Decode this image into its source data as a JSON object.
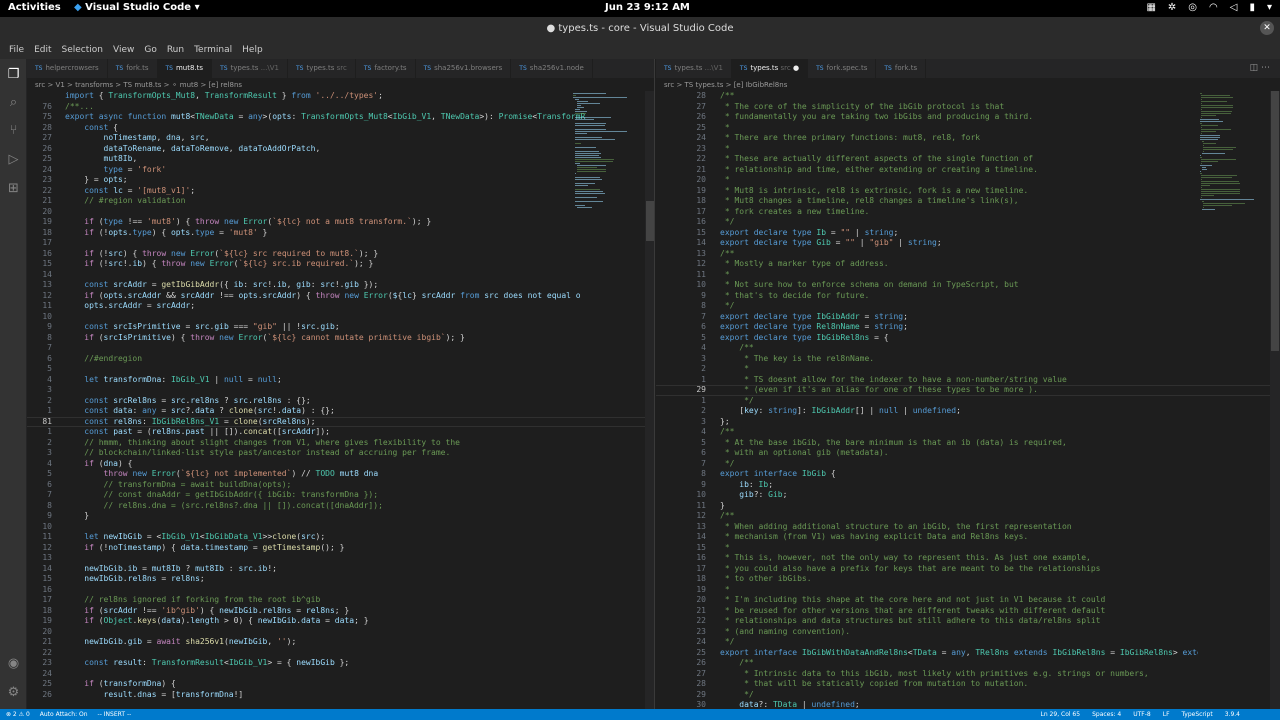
{
  "topbar": {
    "activities": "Activities",
    "app": "Visual Studio Code",
    "clock": "Jun 23  9:12 AM"
  },
  "window": {
    "title": "● types.ts - core - Visual Studio Code"
  },
  "menu": [
    "File",
    "Edit",
    "Selection",
    "View",
    "Go",
    "Run",
    "Terminal",
    "Help"
  ],
  "left": {
    "tabs": [
      {
        "label": "helpercrowsers",
        "dir": "",
        "on": false
      },
      {
        "label": "fork.ts",
        "dir": "",
        "on": false
      },
      {
        "label": "mut8.ts",
        "dir": "",
        "on": true
      },
      {
        "label": "types.ts",
        "dir": "...\\V1",
        "on": false
      },
      {
        "label": "types.ts",
        "dir": "src",
        "on": false
      },
      {
        "label": "factory.ts",
        "dir": "",
        "on": false
      },
      {
        "label": "sha256v1.browsers",
        "dir": "",
        "on": false
      },
      {
        "label": "sha256v1.node",
        "dir": "",
        "on": false
      }
    ],
    "breadcrumb": "src > V1 > transforms > TS mut8.ts > ⚬ mut8 > [e] rel8ns",
    "lines": [
      {
        "n": "",
        "t": "import { TransformOpts_Mut8, TransformResult } from '../../types';"
      },
      {
        "n": "76",
        "t": "/**..."
      },
      {
        "n": "75",
        "t": "export async function mut8<TNewData = any>(opts: TransformOpts_Mut8<IbGib_V1, TNewData>): Promise<TransformR"
      },
      {
        "n": "28",
        "t": "    const {"
      },
      {
        "n": "27",
        "t": "        noTimestamp, dna, src,"
      },
      {
        "n": "26",
        "t": "        dataToRename, dataToRemove, dataToAddOrPatch,"
      },
      {
        "n": "25",
        "t": "        mut8Ib,"
      },
      {
        "n": "24",
        "t": "        type = 'fork'"
      },
      {
        "n": "23",
        "t": "    } = opts;"
      },
      {
        "n": "22",
        "t": "    const lc = '[mut8_v1]';"
      },
      {
        "n": "21",
        "t": "    // #region validation"
      },
      {
        "n": "20",
        "t": ""
      },
      {
        "n": "19",
        "t": "    if (type !== 'mut8') { throw new Error(`${lc} not a mut8 transform.`); }"
      },
      {
        "n": "18",
        "t": "    if (!opts.type) { opts.type = 'mut8' }"
      },
      {
        "n": "17",
        "t": ""
      },
      {
        "n": "16",
        "t": "    if (!src) { throw new Error(`${lc} src required to mut8.`); }"
      },
      {
        "n": "15",
        "t": "    if (!src!.ib) { throw new Error(`${lc} src.ib required.`); }"
      },
      {
        "n": "14",
        "t": ""
      },
      {
        "n": "13",
        "t": "    const srcAddr = getIbGibAddr({ ib: src!.ib, gib: src!.gib });"
      },
      {
        "n": "12",
        "t": "    if (opts.srcAddr && srcAddr !== opts.srcAddr) { throw new Error(`${lc} srcAddr from src does not equal o"
      },
      {
        "n": "11",
        "t": "    opts.srcAddr = srcAddr;"
      },
      {
        "n": "10",
        "t": ""
      },
      {
        "n": "9",
        "t": "    const srcIsPrimitive = src.gib === \"gib\" || !src.gib;"
      },
      {
        "n": "8",
        "t": "    if (srcIsPrimitive) { throw new Error(`${lc} cannot mutate primitive ibgib`); }"
      },
      {
        "n": "7",
        "t": ""
      },
      {
        "n": "6",
        "t": "    //#endregion"
      },
      {
        "n": "5",
        "t": ""
      },
      {
        "n": "4",
        "t": "    let transformDna: IbGib_V1 | null = null;"
      },
      {
        "n": "3",
        "t": ""
      },
      {
        "n": "2",
        "t": "    const srcRel8ns = src.rel8ns ? src.rel8ns : {};"
      },
      {
        "n": "1",
        "t": "    const data: any = src?.data ? clone(src!.data) : {};"
      },
      {
        "n": "81",
        "t": "    const rel8ns: IbGibRel8ns_V1 = clone(srcRel8ns);",
        "cur": true
      },
      {
        "n": "1",
        "t": "    const past = (rel8ns.past || []).concat([srcAddr]);"
      },
      {
        "n": "2",
        "t": "    // hmmm, thinking about slight changes from V1, where gives flexibility to the"
      },
      {
        "n": "3",
        "t": "    // blockchain/linked-list style past/ancestor instead of accruing per frame."
      },
      {
        "n": "4",
        "t": "    if (dna) {"
      },
      {
        "n": "5",
        "t": "        throw new Error(`${lc} not implemented`) // TODO mut8 dna"
      },
      {
        "n": "6",
        "t": "        // transformDna = await buildDna(opts);"
      },
      {
        "n": "7",
        "t": "        // const dnaAddr = getIbGibAddr({ ibGib: transformDna });"
      },
      {
        "n": "8",
        "t": "        // rel8ns.dna = (src.rel8ns?.dna || []).concat([dnaAddr]);"
      },
      {
        "n": "9",
        "t": "    }"
      },
      {
        "n": "10",
        "t": ""
      },
      {
        "n": "11",
        "t": "    let newIbGib = <IbGib_V1<IbGibData_V1>>clone(src);"
      },
      {
        "n": "12",
        "t": "    if (!noTimestamp) { data.timestamp = getTimestamp(); }"
      },
      {
        "n": "13",
        "t": ""
      },
      {
        "n": "14",
        "t": "    newIbGib.ib = mut8Ib ? mut8Ib : src.ib!;"
      },
      {
        "n": "15",
        "t": "    newIbGib.rel8ns = rel8ns;"
      },
      {
        "n": "16",
        "t": ""
      },
      {
        "n": "17",
        "t": "    // rel8ns ignored if forking from the root ib^gib"
      },
      {
        "n": "18",
        "t": "    if (srcAddr !== 'ib^gib') { newIbGib.rel8ns = rel8ns; }"
      },
      {
        "n": "19",
        "t": "    if (Object.keys(data).length > 0) { newIbGib.data = data; }"
      },
      {
        "n": "20",
        "t": ""
      },
      {
        "n": "21",
        "t": "    newIbGib.gib = await sha256v1(newIbGib, '');"
      },
      {
        "n": "22",
        "t": ""
      },
      {
        "n": "23",
        "t": "    const result: TransformResult<IbGib_V1> = { newIbGib };"
      },
      {
        "n": "24",
        "t": ""
      },
      {
        "n": "25",
        "t": "    if (transformDna) {"
      },
      {
        "n": "26",
        "t": "        result.dnas = [transformDna!]"
      }
    ]
  },
  "right": {
    "tabs": [
      {
        "label": "types.ts",
        "dir": "...\\V1",
        "on": false
      },
      {
        "label": "types.ts",
        "dir": "src",
        "on": true,
        "dirty": "●"
      },
      {
        "label": "fork.spec.ts",
        "dir": "",
        "on": false
      },
      {
        "label": "fork.ts",
        "dir": "",
        "on": false
      }
    ],
    "breadcrumb": "src > TS types.ts > [e] IbGibRel8ns",
    "lines": [
      {
        "n": "28",
        "t": "/**"
      },
      {
        "n": "27",
        "t": " * The core of the simplicity of the ibGib protocol is that"
      },
      {
        "n": "26",
        "t": " * fundamentally you are taking two ibGibs and producing a third."
      },
      {
        "n": "25",
        "t": " *"
      },
      {
        "n": "24",
        "t": " * There are three primary functions: mut8, rel8, fork"
      },
      {
        "n": "23",
        "t": " *"
      },
      {
        "n": "22",
        "t": " * These are actually different aspects of the single function of"
      },
      {
        "n": "21",
        "t": " * relationship and time, either extending or creating a timeline."
      },
      {
        "n": "20",
        "t": " *"
      },
      {
        "n": "19",
        "t": " * Mut8 is intrinsic, rel8 is extrinsic, fork is a new timeline."
      },
      {
        "n": "18",
        "t": " * Mut8 changes a timeline, rel8 changes a timeline's link(s),"
      },
      {
        "n": "17",
        "t": " * fork creates a new timeline."
      },
      {
        "n": "16",
        "t": " */"
      },
      {
        "n": "15",
        "t": "export declare type Ib = \"\" | string;"
      },
      {
        "n": "14",
        "t": "export declare type Gib = \"\" | \"gib\" | string;"
      },
      {
        "n": "13",
        "t": "/**"
      },
      {
        "n": "12",
        "t": " * Mostly a marker type of address."
      },
      {
        "n": "11",
        "t": " *"
      },
      {
        "n": "10",
        "t": " * Not sure how to enforce schema on demand in TypeScript, but"
      },
      {
        "n": "9",
        "t": " * that's to decide for future."
      },
      {
        "n": "8",
        "t": " */"
      },
      {
        "n": "7",
        "t": "export declare type IbGibAddr = string;"
      },
      {
        "n": "6",
        "t": "export declare type Rel8nName = string;"
      },
      {
        "n": "5",
        "t": "export declare type IbGibRel8ns = {"
      },
      {
        "n": "4",
        "t": "    /**"
      },
      {
        "n": "3",
        "t": "     * The key is the rel8nName."
      },
      {
        "n": "2",
        "t": "     *"
      },
      {
        "n": "1",
        "t": "     * TS doesnt allow for the indexer to have a non-number/string value"
      },
      {
        "n": "29",
        "t": "     * (even if it's an alias for one of these types to be more ).",
        "cur": true
      },
      {
        "n": "1",
        "t": "     */"
      },
      {
        "n": "2",
        "t": "    [key: string]: IbGibAddr[] | null | undefined;"
      },
      {
        "n": "3",
        "t": "};"
      },
      {
        "n": "4",
        "t": "/**"
      },
      {
        "n": "5",
        "t": " * At the base ibGib, the bare minimum is that an ib (data) is required,"
      },
      {
        "n": "6",
        "t": " * with an optional gib (metadata)."
      },
      {
        "n": "7",
        "t": " */"
      },
      {
        "n": "8",
        "t": "export interface IbGib {"
      },
      {
        "n": "9",
        "t": "    ib: Ib;"
      },
      {
        "n": "10",
        "t": "    gib?: Gib;"
      },
      {
        "n": "11",
        "t": "}"
      },
      {
        "n": "12",
        "t": "/**"
      },
      {
        "n": "13",
        "t": " * When adding additional structure to an ibGib, the first representation"
      },
      {
        "n": "14",
        "t": " * mechanism (from V1) was having explicit Data and Rel8ns keys."
      },
      {
        "n": "15",
        "t": " *"
      },
      {
        "n": "16",
        "t": " * This is, however, not the only way to represent this. As just one example,"
      },
      {
        "n": "17",
        "t": " * you could also have a prefix for keys that are meant to be the relationships"
      },
      {
        "n": "18",
        "t": " * to other ibGibs."
      },
      {
        "n": "19",
        "t": " *"
      },
      {
        "n": "20",
        "t": " * I'm including this shape at the core here and not just in V1 because it could"
      },
      {
        "n": "21",
        "t": " * be reused for other versions that are different tweaks with different default"
      },
      {
        "n": "22",
        "t": " * relationships and data structures but still adhere to this data/rel8ns split"
      },
      {
        "n": "23",
        "t": " * (and naming convention)."
      },
      {
        "n": "24",
        "t": " */"
      },
      {
        "n": "25",
        "t": "export interface IbGibWithDataAndRel8ns<TData = any, TRel8ns extends IbGibRel8ns = IbGibRel8ns> extends IbGi"
      },
      {
        "n": "26",
        "t": "    /**"
      },
      {
        "n": "27",
        "t": "     * Intrinsic data to this ibGib, most likely with primitives e.g. strings or numbers,"
      },
      {
        "n": "28",
        "t": "     * that will be statically copied from mutation to mutation."
      },
      {
        "n": "29",
        "t": "     */"
      },
      {
        "n": "30",
        "t": "    data?: TData | undefined;"
      }
    ]
  },
  "status": {
    "left": [
      "⊗ 2  ⚠ 0",
      "Auto Attach: On",
      "-- INSERT --"
    ],
    "right": [
      "Ln 29, Col 65",
      "Spaces: 4",
      "UTF-8",
      "LF",
      "TypeScript",
      "3.9.4"
    ]
  },
  "colors": {
    "keyword": "#569cd6",
    "control": "#c586c0",
    "type": "#4ec9b0",
    "string": "#ce9178",
    "comment": "#6a9955",
    "func": "#dcdcaa",
    "var": "#9cdcfe",
    "text": "#d4d4d4",
    "status": "#007acc"
  }
}
